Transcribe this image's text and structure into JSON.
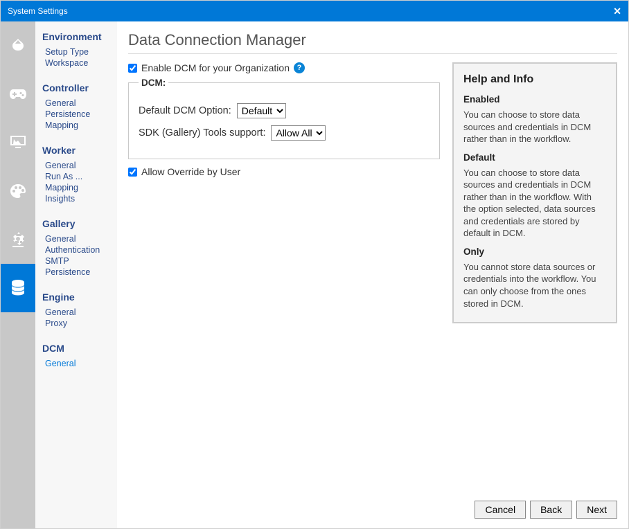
{
  "window": {
    "title": "System Settings"
  },
  "iconbar": [
    "leaf",
    "controller",
    "worker",
    "palette",
    "engine",
    "dcm"
  ],
  "nav": [
    {
      "title": "Environment",
      "items": [
        "Setup Type",
        "Workspace"
      ]
    },
    {
      "title": "Controller",
      "items": [
        "General",
        "Persistence",
        "Mapping"
      ]
    },
    {
      "title": "Worker",
      "items": [
        "General",
        "Run As ...",
        "Mapping",
        "Insights"
      ]
    },
    {
      "title": "Gallery",
      "items": [
        "General",
        "Authentication",
        "SMTP",
        "Persistence"
      ]
    },
    {
      "title": "Engine",
      "items": [
        "General",
        "Proxy"
      ]
    },
    {
      "title": "DCM",
      "items": [
        "General"
      ],
      "selected": 0
    }
  ],
  "page": {
    "title": "Data Connection Manager",
    "enable_checkbox_label": "Enable DCM for your Organization",
    "enable_checked": true,
    "fieldset_legend": "DCM:",
    "default_option_label": "Default DCM Option:",
    "default_option_value": "Default",
    "sdk_label": "SDK (Gallery) Tools support:",
    "sdk_value": "Allow All",
    "override_label": "Allow Override by User",
    "override_checked": true
  },
  "help": {
    "heading": "Help and Info",
    "sections": [
      {
        "title": "Enabled",
        "body": "You can choose to store data sources and credentials in DCM rather than in the workflow."
      },
      {
        "title": "Default",
        "body": "You can choose to store data sources and credentials in DCM rather than in the workflow. With the option selected, data sources and credentials are stored by default in DCM."
      },
      {
        "title": "Only",
        "body": "You cannot store data sources or credentials into the workflow. You can only choose from the ones stored in DCM."
      }
    ]
  },
  "footer": {
    "cancel": "Cancel",
    "back": "Back",
    "next": "Next"
  }
}
